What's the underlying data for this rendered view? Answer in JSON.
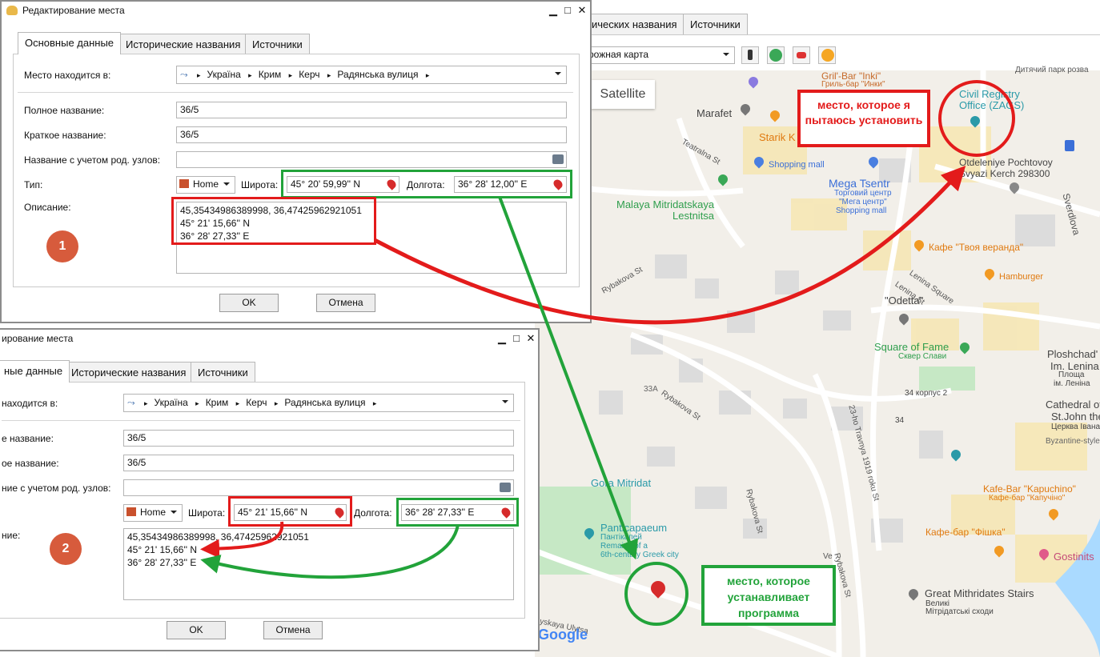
{
  "main_window": {
    "tabs": [
      "ических названия",
      "Источники"
    ],
    "map_type": "рожная карта",
    "map_view_button": "Satellite",
    "toolbar_icons": [
      "traffic-icon",
      "bicycle-icon",
      "car-icon",
      "pegman-icon"
    ]
  },
  "map": {
    "labels": {
      "gril_bar": "Gril'-Bar \"Inki\"",
      "gril_bar_ru": "Гриль-бар \"Инки\"",
      "childrens_park": "Дитячий парк розва",
      "marafet": "Marafet",
      "starik": "Starik K",
      "civil_registry_1": "Civil Registry",
      "civil_registry_2": "Office (ZAGS)",
      "otdeleniye_1": "Otdeleniye Pochtovoy",
      "otdeleniye_2": "Svyazi Kerch 298300",
      "sverdlova": "Sverdlova",
      "shopping_mall": "Shopping mall",
      "mega_tsentr": "Mega Tsentr",
      "mega_ru_1": "Торговий центр",
      "mega_ru_2": "\"Мега центр\"",
      "mega_ru_3": "Shopping mall",
      "malaya_1": "Malaya Mitridatskaya",
      "malaya_2": "Lestnitsa",
      "cafe_veranda": "Кафе \"Твоя веранда\"",
      "hamburger": "Hamburger",
      "lenina_square": "Lenina Square",
      "odetta": "\"Odetta\"",
      "square_fame": "Square of Fame",
      "square_fame_ru": "Сквер Слави",
      "ploshchad_1": "Ploshchad'",
      "ploshchad_2": "Im. Lenina",
      "ploshchad_3": "Площа",
      "ploshchad_4": "ім. Леніна",
      "cathedral_1": "Cathedral of J",
      "cathedral_2": "St.John the",
      "cathedral_3": "Церква Івана",
      "byzantine": "Byzantine-style",
      "gora": "Gora Mitridat",
      "kafe_kapuchino": "Kafe-Bar \"Kapuchino\"",
      "kafe_kapuchino_ru": "Кафе-бар \"Капучіно\"",
      "kafe_fishka": "Кафе-бар \"Фішка\"",
      "gostinits": "Gostinits",
      "panti_1": "Panticapaeum",
      "panti_2": "Пантікапей",
      "panti_3": "Remains of a",
      "panti_4": "6th-century Greek city",
      "great_stairs_1": "Great Mithridates Stairs",
      "great_stairs_2": "Великі",
      "great_stairs_3": "Мітрідатські сходи",
      "korpus": "34 корпус 2",
      "n33a": "33A",
      "n34": "34",
      "google": "Google"
    },
    "streets": {
      "teatralna": "Teatralna St",
      "rybakova1": "Rybakova St",
      "rybakova2": "Rybakova St",
      "rybakova3": "Rybakova St",
      "rybakova4": "Rybakova St",
      "tramvaya": "23-ho Travnya 1919 roku St",
      "lenina": "Lenina St",
      "lenina2": "Lenina Square",
      "reyskaya": "eyskaya Ulytsa",
      "ve": "Ve"
    }
  },
  "dialog1": {
    "title": "Редактирование места",
    "tabs": [
      "Основные данные",
      "Исторические названия",
      "Источники"
    ],
    "location_label": "Место находится в:",
    "breadcrumb": [
      "Україна",
      "Крим",
      "Керч",
      "Радянська вулиця"
    ],
    "full_name_label": "Полное название:",
    "full_name": "36/5",
    "short_name_label": "Краткое название:",
    "short_name": "36/5",
    "name_with_parents_label": "Название с учетом род. узлов:",
    "type_label": "Тип:",
    "type_value": "Home",
    "lat_label": "Широта:",
    "lat_value": "45° 20' 59,99'' N",
    "lon_label": "Долгота:",
    "lon_value": "36° 28' 12,00'' E",
    "desc_label": "Описание:",
    "desc_value": "45,35434986389998, 36,47425962921051\n45° 21' 15,66'' N\n36° 28' 27,33'' E",
    "ok": "OK",
    "cancel": "Отмена",
    "badge": "1"
  },
  "dialog2": {
    "title": "ирование места",
    "tabs": [
      "ные данные",
      "Исторические названия",
      "Источники"
    ],
    "location_label": "находится в:",
    "breadcrumb": [
      "Україна",
      "Крим",
      "Керч",
      "Радянська вулиця"
    ],
    "full_name_label": "е название:",
    "full_name": "36/5",
    "short_name_label": "ое название:",
    "short_name": "36/5",
    "name_with_parents_label": "ние с учетом род. узлов:",
    "type_value": "Home",
    "lat_label": "Широта:",
    "lat_value": "45° 21' 15,66'' N",
    "lon_label": "Долгота:",
    "lon_value": "36° 28' 27,33'' E",
    "desc_label": "ние:",
    "desc_value": "45,35434986389998, 36,47425962921051\n45° 21' 15,66'' N\n36° 28' 27,33'' E",
    "ok": "OK",
    "cancel": "Отмена",
    "badge": "2"
  },
  "annotations": {
    "red_callout": "место, которое я пытаюсь установить",
    "green_callout": "место, которое устанавливает программа"
  },
  "colors": {
    "red": "#e31b1b",
    "green": "#22a33a",
    "badge": "#d75b3c",
    "map_bg": "#f2efe9"
  }
}
